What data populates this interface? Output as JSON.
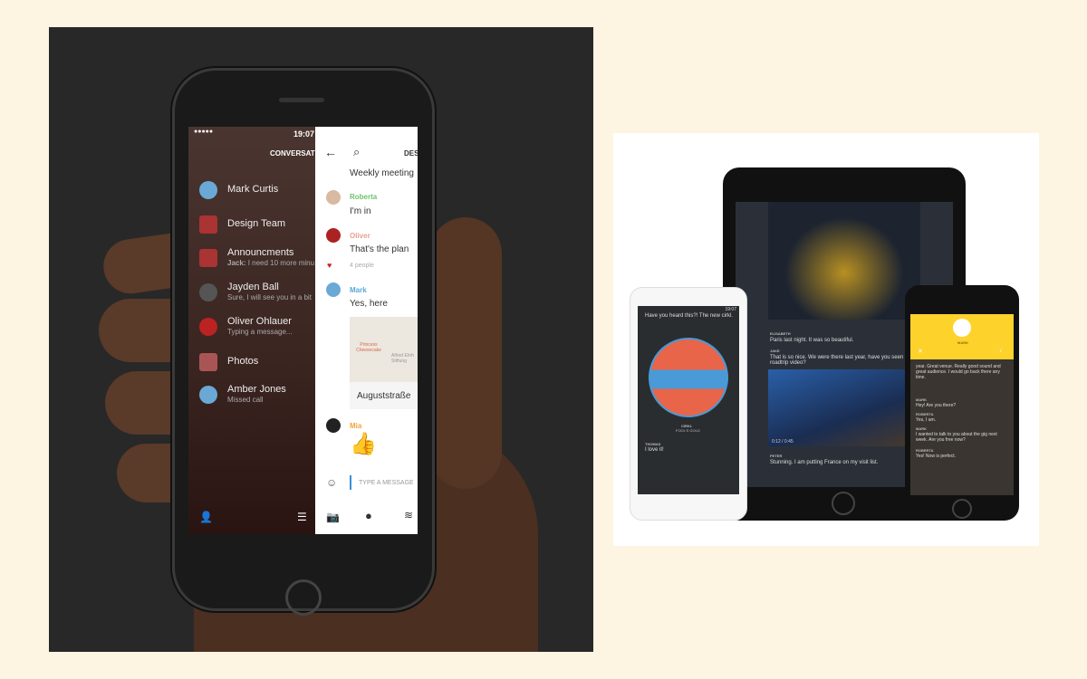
{
  "left_phone": {
    "status_time": "19:07",
    "signal": "●●●●●",
    "list_title": "CONVERSAT",
    "conversations": [
      {
        "name": "Mark Curtis",
        "subtitle": ""
      },
      {
        "name": "Design Team",
        "subtitle": ""
      },
      {
        "name": "Announcments",
        "subtitle_sender": "Jack:",
        "subtitle": "I need 10 more minu"
      },
      {
        "name": "Jayden Ball",
        "subtitle": "Sure, I will see you in a bit"
      },
      {
        "name": "Oliver Ohlauer",
        "subtitle": "Typing a message..."
      },
      {
        "name": "Photos",
        "subtitle": ""
      },
      {
        "name": "Amber Jones",
        "subtitle": "Missed call"
      }
    ],
    "chat_header_title": "DES",
    "chat": {
      "first_line": "Weekly meeting",
      "messages": [
        {
          "sender": "Roberta",
          "text": "I'm in",
          "color": "#6cc36a"
        },
        {
          "sender": "Oliver",
          "text": "That's the plan",
          "color": "#e8a090"
        },
        {
          "sender": "Mark",
          "text": "Yes, here",
          "color": "#5aa6d6"
        },
        {
          "sender": "Mia",
          "text": "👍",
          "color": "#f2a23a"
        }
      ],
      "reaction": "4 people",
      "map_place1": "Princess Cheesecake",
      "map_place2": "Alfred Ehrh Stiftung",
      "map_caption": "Auguststraße",
      "input_placeholder": "TYPE A MESSAGE"
    }
  },
  "android": {
    "time": "19:07",
    "message": "Have you heard this?! The new cirkl.",
    "track_title": "CIRKL",
    "track_artist": "FOOL'S GOLD",
    "reply_sender": "THOMAS",
    "reply": "I love it!"
  },
  "tablet": {
    "messages": [
      {
        "sender": "ELISABETH",
        "text": "Paris last night. It was so beautiful."
      },
      {
        "sender": "JAKE",
        "text": "That is so nice. We were there last year, have you seen our roadtrip video?"
      },
      {
        "sender": "PETER",
        "text": "Stunning. I am putting France on my visit list."
      }
    ],
    "video_time": "0:12 / 0:45"
  },
  "iphone": {
    "caller": "MARK",
    "accent": "#fdd22b",
    "messages": [
      {
        "sender": "",
        "text": "year. Great venue. Really good sound and great audience. I would go back there any time."
      },
      {
        "sender": "MARK",
        "text": "Hey! Are you there?"
      },
      {
        "sender": "ROBERTA",
        "text": "Yes, I am."
      },
      {
        "sender": "MARK",
        "text": "I wanted to talk to you about the gig next week. Are you free now?"
      },
      {
        "sender": "ROBERTA",
        "text": "Yes! Now is perfect."
      }
    ]
  }
}
